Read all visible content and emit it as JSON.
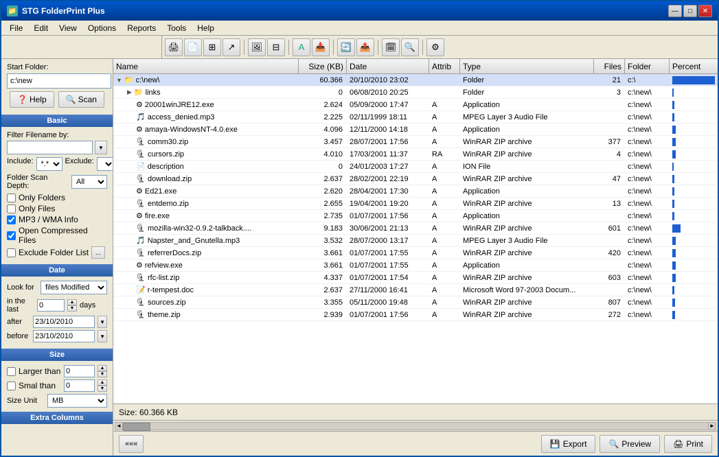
{
  "window": {
    "title": "STG FolderPrint Plus",
    "icon": "📁"
  },
  "menu": {
    "items": [
      "File",
      "Edit",
      "View",
      "Options",
      "Reports",
      "Tools",
      "Help"
    ]
  },
  "left_panel": {
    "start_folder_label": "Start Folder:",
    "folder_value": "c:\\new",
    "help_btn": "Help",
    "scan_btn": "Scan",
    "basic_header": "Basic",
    "filter_label": "Filter Filename by:",
    "include_label": "Include:",
    "include_value": "*.*",
    "exclude_label": "Exclude:",
    "depth_label": "Folder Scan Depth:",
    "depth_value": "All",
    "only_folders": "Only Folders",
    "only_files": "Only Files",
    "mp3_wma": "MP3 / WMA Info",
    "open_compressed": "Open Compressed Files",
    "exclude_folder_list": "Exclude Folder List",
    "date_header": "Date",
    "look_for_label": "Look for",
    "look_for_value": "files Modified",
    "in_the_last_label": "in the last",
    "in_last_value": "0",
    "days_label": "days",
    "after_label": "after",
    "after_value": "23/10/2010",
    "before_label": "before",
    "before_value": "23/10/2010",
    "size_header": "Size",
    "larger_than_label": "Larger than",
    "larger_value": "0",
    "smaller_than_label": "Smal than",
    "smaller_value": "0",
    "size_unit_label": "Size Unit",
    "size_unit_value": "MB",
    "extra_columns_header": "Extra Columns"
  },
  "file_list": {
    "columns": {
      "name": "Name",
      "size": "Size (KB)",
      "date": "Date",
      "attrib": "Attrib",
      "type": "Type",
      "files": "Files",
      "folder": "Folder",
      "percent": "Percent"
    },
    "rows": [
      {
        "name": "c:\\new\\",
        "indent": 0,
        "expand": true,
        "icon": "folder",
        "size": "60.366",
        "date": "20/10/2010 23:02",
        "attrib": "",
        "type": "Folder",
        "files": "21",
        "folder": "c:\\",
        "percent": 95
      },
      {
        "name": "links",
        "indent": 1,
        "expand": false,
        "icon": "folder",
        "size": "0",
        "date": "06/08/2010 20:25",
        "attrib": "",
        "type": "Folder",
        "files": "3",
        "folder": "c:\\new\\",
        "percent": 2
      },
      {
        "name": "20001winJRE12.exe",
        "indent": 1,
        "expand": false,
        "icon": "exe",
        "size": "2.624",
        "date": "05/09/2000 17:47",
        "attrib": "A",
        "type": "Application",
        "files": "",
        "folder": "c:\\new\\",
        "percent": 5
      },
      {
        "name": "access_denied.mp3",
        "indent": 1,
        "expand": false,
        "icon": "audio",
        "size": "2.225",
        "date": "02/11/1999 18:11",
        "attrib": "A",
        "type": "MPEG Layer 3 Audio File",
        "files": "",
        "folder": "c:\\new\\",
        "percent": 4
      },
      {
        "name": "amaya-WindowsNT-4.0.exe",
        "indent": 1,
        "expand": false,
        "icon": "exe",
        "size": "4.096",
        "date": "12/11/2000 14:18",
        "attrib": "A",
        "type": "Application",
        "files": "",
        "folder": "c:\\new\\",
        "percent": 8
      },
      {
        "name": "comm30.zip",
        "indent": 1,
        "expand": false,
        "icon": "zip",
        "size": "3.457",
        "date": "28/07/2001 17:56",
        "attrib": "A",
        "type": "WinRAR ZIP archive",
        "files": "377",
        "folder": "c:\\new\\",
        "percent": 7
      },
      {
        "name": "cursors.zip",
        "indent": 1,
        "expand": false,
        "icon": "zip",
        "size": "4.010",
        "date": "17/03/2001 11:37",
        "attrib": "RA",
        "type": "WinRAR ZIP archive",
        "files": "4",
        "folder": "c:\\new\\",
        "percent": 8
      },
      {
        "name": "description",
        "indent": 1,
        "expand": false,
        "icon": "file",
        "size": "0",
        "date": "24/01/2003 17:27",
        "attrib": "A",
        "type": "ION File",
        "files": "",
        "folder": "c:\\new\\",
        "percent": 1
      },
      {
        "name": "download.zip",
        "indent": 1,
        "expand": false,
        "icon": "zip",
        "size": "2.637",
        "date": "28/02/2001 22:19",
        "attrib": "A",
        "type": "WinRAR ZIP archive",
        "files": "47",
        "folder": "c:\\new\\",
        "percent": 5
      },
      {
        "name": "Ed21.exe",
        "indent": 1,
        "expand": false,
        "icon": "exe",
        "size": "2.620",
        "date": "28/04/2001 17:30",
        "attrib": "A",
        "type": "Application",
        "files": "",
        "folder": "c:\\new\\",
        "percent": 5
      },
      {
        "name": "entdemo.zip",
        "indent": 1,
        "expand": false,
        "icon": "zip",
        "size": "2.655",
        "date": "19/04/2001 19:20",
        "attrib": "A",
        "type": "WinRAR ZIP archive",
        "files": "13",
        "folder": "c:\\new\\",
        "percent": 5
      },
      {
        "name": "fire.exe",
        "indent": 1,
        "expand": false,
        "icon": "exe",
        "size": "2.735",
        "date": "01/07/2001 17:56",
        "attrib": "A",
        "type": "Application",
        "files": "",
        "folder": "c:\\new\\",
        "percent": 5
      },
      {
        "name": "mozilla-win32-0.9.2-talkback....",
        "indent": 1,
        "expand": false,
        "icon": "zip",
        "size": "9.183",
        "date": "30/06/2001 21:13",
        "attrib": "A",
        "type": "WinRAR ZIP archive",
        "files": "601",
        "folder": "c:\\new\\",
        "percent": 18
      },
      {
        "name": "Napster_and_Gnutella.mp3",
        "indent": 1,
        "expand": false,
        "icon": "audio",
        "size": "3.532",
        "date": "28/07/2000 13:17",
        "attrib": "A",
        "type": "MPEG Layer 3 Audio File",
        "files": "",
        "folder": "c:\\new\\",
        "percent": 7
      },
      {
        "name": "referrerDocs.zip",
        "indent": 1,
        "expand": false,
        "icon": "zip",
        "size": "3.661",
        "date": "01/07/2001 17:55",
        "attrib": "A",
        "type": "WinRAR ZIP archive",
        "files": "420",
        "folder": "c:\\new\\",
        "percent": 7
      },
      {
        "name": "refview.exe",
        "indent": 1,
        "expand": false,
        "icon": "exe",
        "size": "3.661",
        "date": "01/07/2001 17:55",
        "attrib": "A",
        "type": "Application",
        "files": "",
        "folder": "c:\\new\\",
        "percent": 7
      },
      {
        "name": "rfc-list.zip",
        "indent": 1,
        "expand": false,
        "icon": "zip",
        "size": "4.337",
        "date": "01/07/2001 17:54",
        "attrib": "A",
        "type": "WinRAR ZIP archive",
        "files": "603",
        "folder": "c:\\new\\",
        "percent": 8
      },
      {
        "name": "r-tempest.doc",
        "indent": 1,
        "expand": false,
        "icon": "doc",
        "size": "2.637",
        "date": "27/11/2000 16:41",
        "attrib": "A",
        "type": "Microsoft Word 97-2003 Docum...",
        "files": "",
        "folder": "c:\\new\\",
        "percent": 5
      },
      {
        "name": "sources.zip",
        "indent": 1,
        "expand": false,
        "icon": "zip",
        "size": "3.355",
        "date": "05/11/2000 19:48",
        "attrib": "A",
        "type": "WinRAR ZIP archive",
        "files": "807",
        "folder": "c:\\new\\",
        "percent": 6
      },
      {
        "name": "theme.zip",
        "indent": 1,
        "expand": false,
        "icon": "zip",
        "size": "2.939",
        "date": "01/07/2001 17:56",
        "attrib": "A",
        "type": "WinRAR ZIP archive",
        "files": "272",
        "folder": "c:\\new\\",
        "percent": 6
      }
    ]
  },
  "status": {
    "size_text": "Size: 60.366  KB"
  },
  "bottom_buttons": {
    "export": "Export",
    "preview": "Preview",
    "print": "Print",
    "nav_back": "«««"
  }
}
